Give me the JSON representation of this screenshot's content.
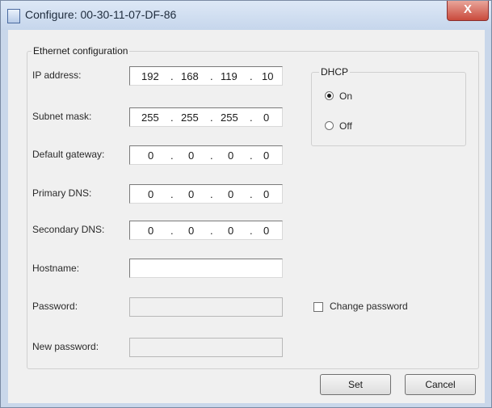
{
  "window": {
    "title": "Configure: 00-30-11-07-DF-86",
    "close_symbol": "X"
  },
  "ethernet": {
    "group_label": "Ethernet configuration",
    "ip_label": "IP address:",
    "ip_octets": [
      "192",
      "168",
      "119",
      "10"
    ],
    "subnet_label": "Subnet mask:",
    "subnet_octets": [
      "255",
      "255",
      "255",
      "0"
    ],
    "gateway_label": "Default gateway:",
    "gateway_octets": [
      "0",
      "0",
      "0",
      "0"
    ],
    "dns1_label": "Primary DNS:",
    "dns1_octets": [
      "0",
      "0",
      "0",
      "0"
    ],
    "dns2_label": "Secondary DNS:",
    "dns2_octets": [
      "0",
      "0",
      "0",
      "0"
    ],
    "hostname_label": "Hostname:",
    "hostname_value": "",
    "password_label": "Password:",
    "new_password_label": "New password:",
    "octet_separator": "."
  },
  "dhcp": {
    "group_label": "DHCP",
    "on_label": "On",
    "off_label": "Off",
    "selected": "On"
  },
  "change_password": {
    "label": "Change password",
    "checked": false
  },
  "buttons": {
    "set": "Set",
    "cancel": "Cancel"
  },
  "icons": {
    "app": "app-icon",
    "close": "close-icon"
  }
}
